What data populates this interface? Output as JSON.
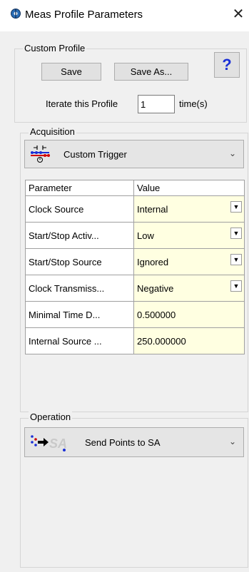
{
  "window": {
    "title": "Meas Profile Parameters",
    "close_symbol": "✕"
  },
  "custom_profile": {
    "legend": "Custom Profile",
    "save_label": "Save",
    "save_as_label": "Save As...",
    "help_label": "?",
    "iterate_label": "Iterate this Profile",
    "iterate_value": "1",
    "times_label": "time(s)"
  },
  "acquisition": {
    "legend": "Acquisition",
    "combo_value": "Custom Trigger",
    "table": {
      "headers": [
        "Parameter",
        "Value"
      ],
      "rows": [
        {
          "param": "Clock Source",
          "value": "Internal",
          "dropdown": true
        },
        {
          "param": "Start/Stop Activ...",
          "value": "Low",
          "dropdown": true
        },
        {
          "param": "Start/Stop Source",
          "value": "Ignored",
          "dropdown": true
        },
        {
          "param": "Clock Transmiss...",
          "value": "Negative",
          "dropdown": true
        },
        {
          "param": "Minimal Time D...",
          "value": "0.500000",
          "dropdown": false
        },
        {
          "param": "Internal Source ...",
          "value": "250.000000",
          "dropdown": false
        }
      ]
    }
  },
  "operation": {
    "legend": "Operation",
    "combo_value": "Send Points to SA"
  },
  "colors": {
    "value_cell_bg": "#ffffe1",
    "help_blue": "#1a2fd6",
    "accent_red": "#d00000",
    "accent_blue": "#1a2fd6"
  },
  "icons": {
    "title": "app-icon",
    "acquisition": "custom-trigger-icon",
    "operation": "send-points-sa-icon",
    "dropdown": "dropdown-arrow-icon",
    "chevron": "chevron-down-icon"
  }
}
